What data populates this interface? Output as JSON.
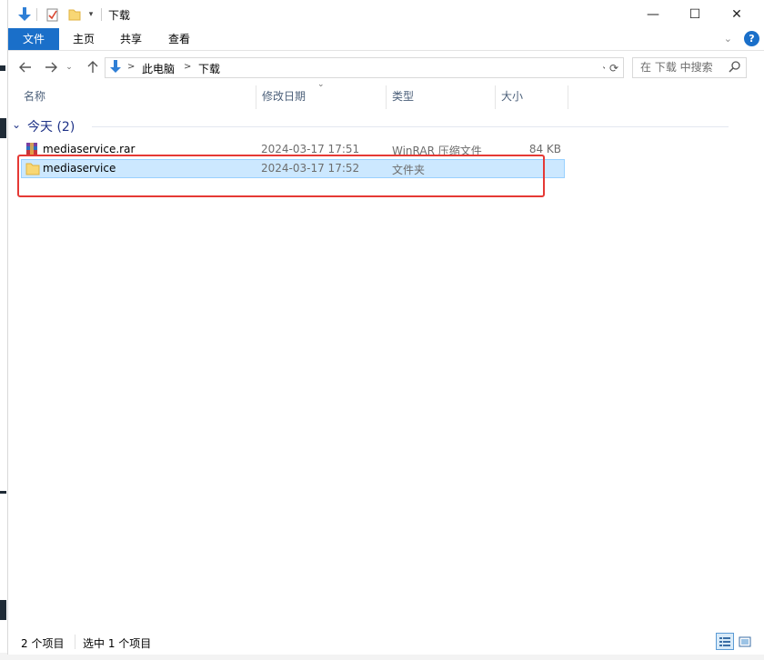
{
  "window": {
    "title": "下载"
  },
  "title_bar": {
    "minimize_glyph": "—",
    "maximize_glyph": "☐",
    "close_glyph": "✕"
  },
  "ribbon": {
    "tabs": [
      {
        "label": "文件",
        "active": true
      },
      {
        "label": "主页"
      },
      {
        "label": "共享"
      },
      {
        "label": "查看"
      }
    ],
    "help_glyph": "?"
  },
  "navigation": {
    "breadcrumb": [
      "此电脑",
      "下载"
    ],
    "separator": ">",
    "search_placeholder": "在 下载 中搜索"
  },
  "columns": [
    "名称",
    "修改日期",
    "类型",
    "大小"
  ],
  "group": {
    "label": "今天 (2)"
  },
  "files": [
    {
      "name": "mediaservice.rar",
      "modified": "2024-03-17 17:51",
      "type": "WinRAR 压缩文件",
      "size": "84 KB",
      "icon": "winrar-archive-icon",
      "selected": false
    },
    {
      "name": "mediaservice",
      "modified": "2024-03-17 17:52",
      "type": "文件夹",
      "size": "",
      "icon": "folder-icon",
      "selected": true
    }
  ],
  "status": {
    "item_count": "2 个项目",
    "selection": "选中 1 个项目"
  },
  "colors": {
    "accent": "#1a6fc9",
    "selection_bg": "#cce8ff",
    "highlight_box": "#e53935",
    "group_text": "#1e3287"
  }
}
